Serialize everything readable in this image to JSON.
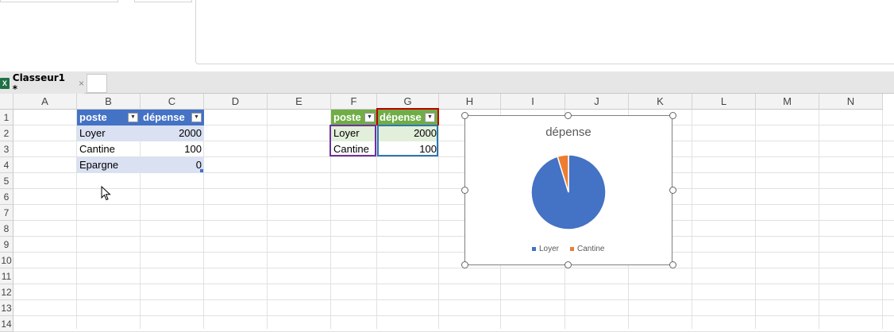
{
  "workbook_tab": {
    "title": "Classeur1 *",
    "close": "×",
    "icon_letter": "X"
  },
  "columns": [
    "A",
    "B",
    "C",
    "D",
    "E",
    "F",
    "G",
    "H",
    "I",
    "J",
    "K",
    "L",
    "M",
    "N"
  ],
  "rows": [
    "1",
    "2",
    "3",
    "4",
    "5",
    "6",
    "7",
    "8",
    "9",
    "10",
    "11",
    "12",
    "13",
    "14"
  ],
  "table1": {
    "headers": [
      "poste",
      "dépense"
    ],
    "rows": [
      [
        "Loyer",
        "2000"
      ],
      [
        "Cantine",
        "100"
      ],
      [
        "Epargne",
        "0"
      ]
    ]
  },
  "table2": {
    "headers": [
      "poste",
      "dépense"
    ],
    "rows": [
      [
        "Loyer",
        "2000"
      ],
      [
        "Cantine",
        "100"
      ]
    ]
  },
  "chart_data": {
    "type": "pie",
    "title": "dépense",
    "categories": [
      "Loyer",
      "Cantine"
    ],
    "values": [
      2000,
      100
    ],
    "colors": [
      "#4472c4",
      "#ed7d31"
    ],
    "legend": "bottom"
  },
  "colors": {
    "table1_header": "#4472c4",
    "table2_header": "#70ad47"
  }
}
